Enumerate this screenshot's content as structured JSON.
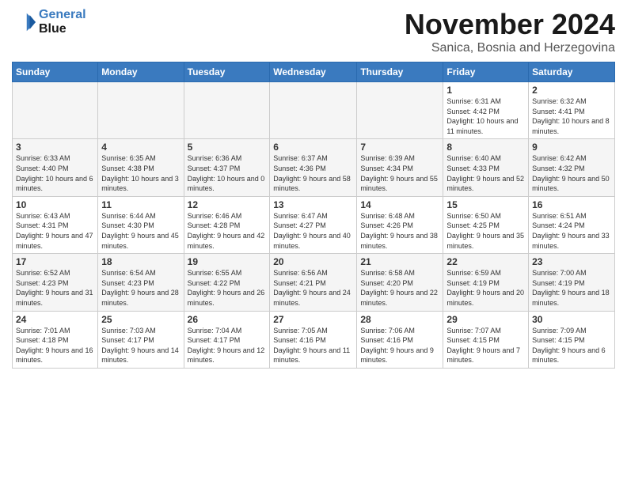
{
  "header": {
    "logo_line1": "General",
    "logo_line2": "Blue",
    "month_title": "November 2024",
    "subtitle": "Sanica, Bosnia and Herzegovina"
  },
  "days_of_week": [
    "Sunday",
    "Monday",
    "Tuesday",
    "Wednesday",
    "Thursday",
    "Friday",
    "Saturday"
  ],
  "weeks": [
    [
      {
        "num": "",
        "info": "",
        "empty": true
      },
      {
        "num": "",
        "info": "",
        "empty": true
      },
      {
        "num": "",
        "info": "",
        "empty": true
      },
      {
        "num": "",
        "info": "",
        "empty": true
      },
      {
        "num": "",
        "info": "",
        "empty": true
      },
      {
        "num": "1",
        "info": "Sunrise: 6:31 AM\nSunset: 4:42 PM\nDaylight: 10 hours and 11 minutes."
      },
      {
        "num": "2",
        "info": "Sunrise: 6:32 AM\nSunset: 4:41 PM\nDaylight: 10 hours and 8 minutes."
      }
    ],
    [
      {
        "num": "3",
        "info": "Sunrise: 6:33 AM\nSunset: 4:40 PM\nDaylight: 10 hours and 6 minutes."
      },
      {
        "num": "4",
        "info": "Sunrise: 6:35 AM\nSunset: 4:38 PM\nDaylight: 10 hours and 3 minutes."
      },
      {
        "num": "5",
        "info": "Sunrise: 6:36 AM\nSunset: 4:37 PM\nDaylight: 10 hours and 0 minutes."
      },
      {
        "num": "6",
        "info": "Sunrise: 6:37 AM\nSunset: 4:36 PM\nDaylight: 9 hours and 58 minutes."
      },
      {
        "num": "7",
        "info": "Sunrise: 6:39 AM\nSunset: 4:34 PM\nDaylight: 9 hours and 55 minutes."
      },
      {
        "num": "8",
        "info": "Sunrise: 6:40 AM\nSunset: 4:33 PM\nDaylight: 9 hours and 52 minutes."
      },
      {
        "num": "9",
        "info": "Sunrise: 6:42 AM\nSunset: 4:32 PM\nDaylight: 9 hours and 50 minutes."
      }
    ],
    [
      {
        "num": "10",
        "info": "Sunrise: 6:43 AM\nSunset: 4:31 PM\nDaylight: 9 hours and 47 minutes."
      },
      {
        "num": "11",
        "info": "Sunrise: 6:44 AM\nSunset: 4:30 PM\nDaylight: 9 hours and 45 minutes."
      },
      {
        "num": "12",
        "info": "Sunrise: 6:46 AM\nSunset: 4:28 PM\nDaylight: 9 hours and 42 minutes."
      },
      {
        "num": "13",
        "info": "Sunrise: 6:47 AM\nSunset: 4:27 PM\nDaylight: 9 hours and 40 minutes."
      },
      {
        "num": "14",
        "info": "Sunrise: 6:48 AM\nSunset: 4:26 PM\nDaylight: 9 hours and 38 minutes."
      },
      {
        "num": "15",
        "info": "Sunrise: 6:50 AM\nSunset: 4:25 PM\nDaylight: 9 hours and 35 minutes."
      },
      {
        "num": "16",
        "info": "Sunrise: 6:51 AM\nSunset: 4:24 PM\nDaylight: 9 hours and 33 minutes."
      }
    ],
    [
      {
        "num": "17",
        "info": "Sunrise: 6:52 AM\nSunset: 4:23 PM\nDaylight: 9 hours and 31 minutes."
      },
      {
        "num": "18",
        "info": "Sunrise: 6:54 AM\nSunset: 4:23 PM\nDaylight: 9 hours and 28 minutes."
      },
      {
        "num": "19",
        "info": "Sunrise: 6:55 AM\nSunset: 4:22 PM\nDaylight: 9 hours and 26 minutes."
      },
      {
        "num": "20",
        "info": "Sunrise: 6:56 AM\nSunset: 4:21 PM\nDaylight: 9 hours and 24 minutes."
      },
      {
        "num": "21",
        "info": "Sunrise: 6:58 AM\nSunset: 4:20 PM\nDaylight: 9 hours and 22 minutes."
      },
      {
        "num": "22",
        "info": "Sunrise: 6:59 AM\nSunset: 4:19 PM\nDaylight: 9 hours and 20 minutes."
      },
      {
        "num": "23",
        "info": "Sunrise: 7:00 AM\nSunset: 4:19 PM\nDaylight: 9 hours and 18 minutes."
      }
    ],
    [
      {
        "num": "24",
        "info": "Sunrise: 7:01 AM\nSunset: 4:18 PM\nDaylight: 9 hours and 16 minutes."
      },
      {
        "num": "25",
        "info": "Sunrise: 7:03 AM\nSunset: 4:17 PM\nDaylight: 9 hours and 14 minutes."
      },
      {
        "num": "26",
        "info": "Sunrise: 7:04 AM\nSunset: 4:17 PM\nDaylight: 9 hours and 12 minutes."
      },
      {
        "num": "27",
        "info": "Sunrise: 7:05 AM\nSunset: 4:16 PM\nDaylight: 9 hours and 11 minutes."
      },
      {
        "num": "28",
        "info": "Sunrise: 7:06 AM\nSunset: 4:16 PM\nDaylight: 9 hours and 9 minutes."
      },
      {
        "num": "29",
        "info": "Sunrise: 7:07 AM\nSunset: 4:15 PM\nDaylight: 9 hours and 7 minutes."
      },
      {
        "num": "30",
        "info": "Sunrise: 7:09 AM\nSunset: 4:15 PM\nDaylight: 9 hours and 6 minutes."
      }
    ]
  ]
}
